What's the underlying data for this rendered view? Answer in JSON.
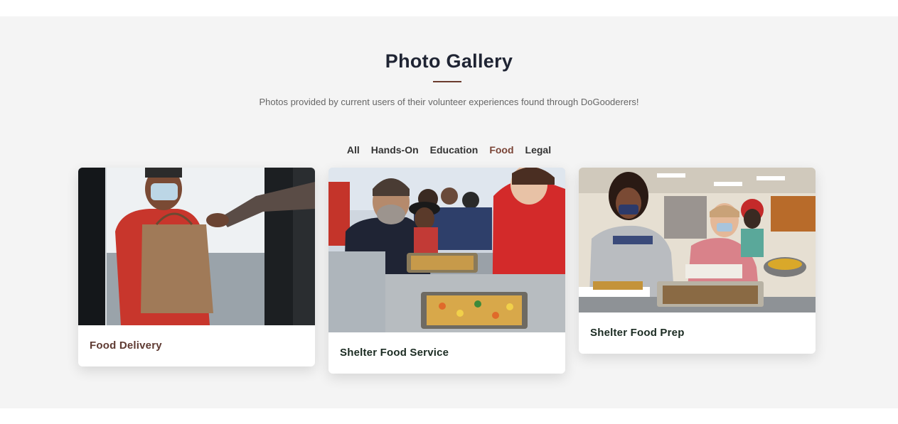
{
  "gallery": {
    "title": "Photo Gallery",
    "subtitle": "Photos provided by current users of their volunteer experiences found through DoGooderers!"
  },
  "filters": {
    "items": [
      "All",
      "Hands-On",
      "Education",
      "Food",
      "Legal"
    ],
    "active": "Food"
  },
  "cards": [
    {
      "title": "Food Delivery",
      "title_color": "#5e3a32"
    },
    {
      "title": "Shelter Food Service",
      "title_color": "#1b2b22"
    },
    {
      "title": "Shelter Food Prep",
      "title_color": "#1b2b22"
    }
  ],
  "colors": {
    "accent": "#7a4436",
    "divider": "#6b3b2e",
    "background": "#f4f4f4"
  }
}
